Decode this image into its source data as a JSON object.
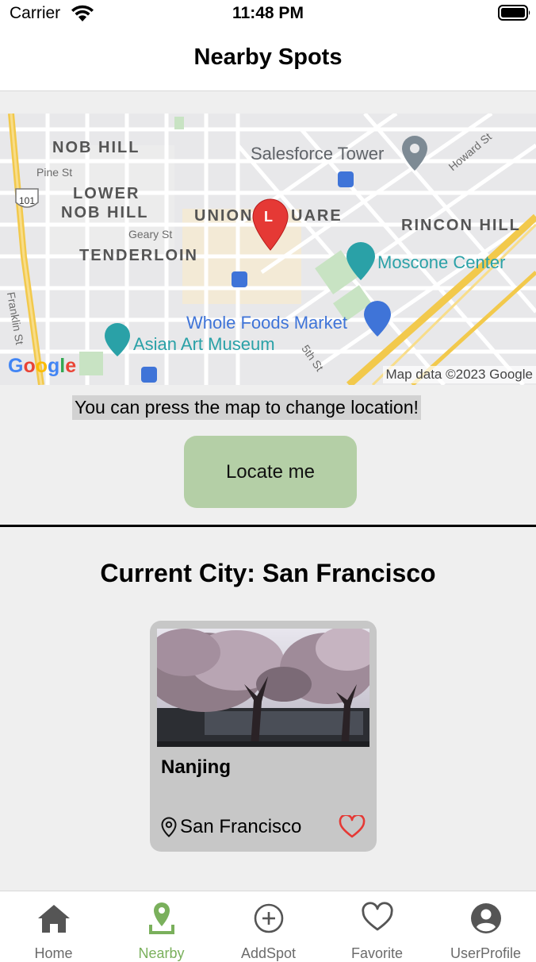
{
  "status_bar": {
    "carrier": "Carrier",
    "time": "11:48 PM"
  },
  "header": {
    "title": "Nearby Spots"
  },
  "map": {
    "labels": {
      "nob_hill": "NOB HILL",
      "pine_st": "Pine St",
      "lower_nob_hill_1": "LOWER",
      "lower_nob_hill_2": "NOB HILL",
      "geary_st": "Geary St",
      "tenderloin": "TENDERLOIN",
      "union_square_1": "UNION",
      "union_square_2": "UARE",
      "rincon_hill": "RINCON HILL",
      "franklin_st": "Franklin St",
      "fifth_st": "5th St",
      "howard_st": "Howard St",
      "highway": "101"
    },
    "pois": {
      "salesforce_tower": "Salesforce Tower",
      "moscone_center": "Moscone Center",
      "whole_foods": "Whole Foods Market",
      "asian_art_museum": "Asian Art Museum"
    },
    "marker_letter": "L",
    "google_logo": [
      "G",
      "o",
      "o",
      "g",
      "l",
      "e"
    ],
    "attribution": "Map data ©2023 Google"
  },
  "hint": "You can press the map to change location!",
  "locate_button": "Locate me",
  "current_city": "Current City: San Francisco",
  "spot": {
    "name": "Nanjing",
    "city": "San Francisco",
    "favorited": true
  },
  "tabs": [
    {
      "label": "Home",
      "icon": "home-icon",
      "active": false
    },
    {
      "label": "Nearby",
      "icon": "location-pin-icon",
      "active": true
    },
    {
      "label": "AddSpot",
      "icon": "add-circle-icon",
      "active": false
    },
    {
      "label": "Favorite",
      "icon": "heart-icon",
      "active": false
    },
    {
      "label": "UserProfile",
      "icon": "user-icon",
      "active": false
    }
  ],
  "colors": {
    "accent_green": "#7ab05c",
    "button_green": "#b4cfa6",
    "heart_red": "#e53935",
    "tab_inactive": "#6b6b6b"
  }
}
